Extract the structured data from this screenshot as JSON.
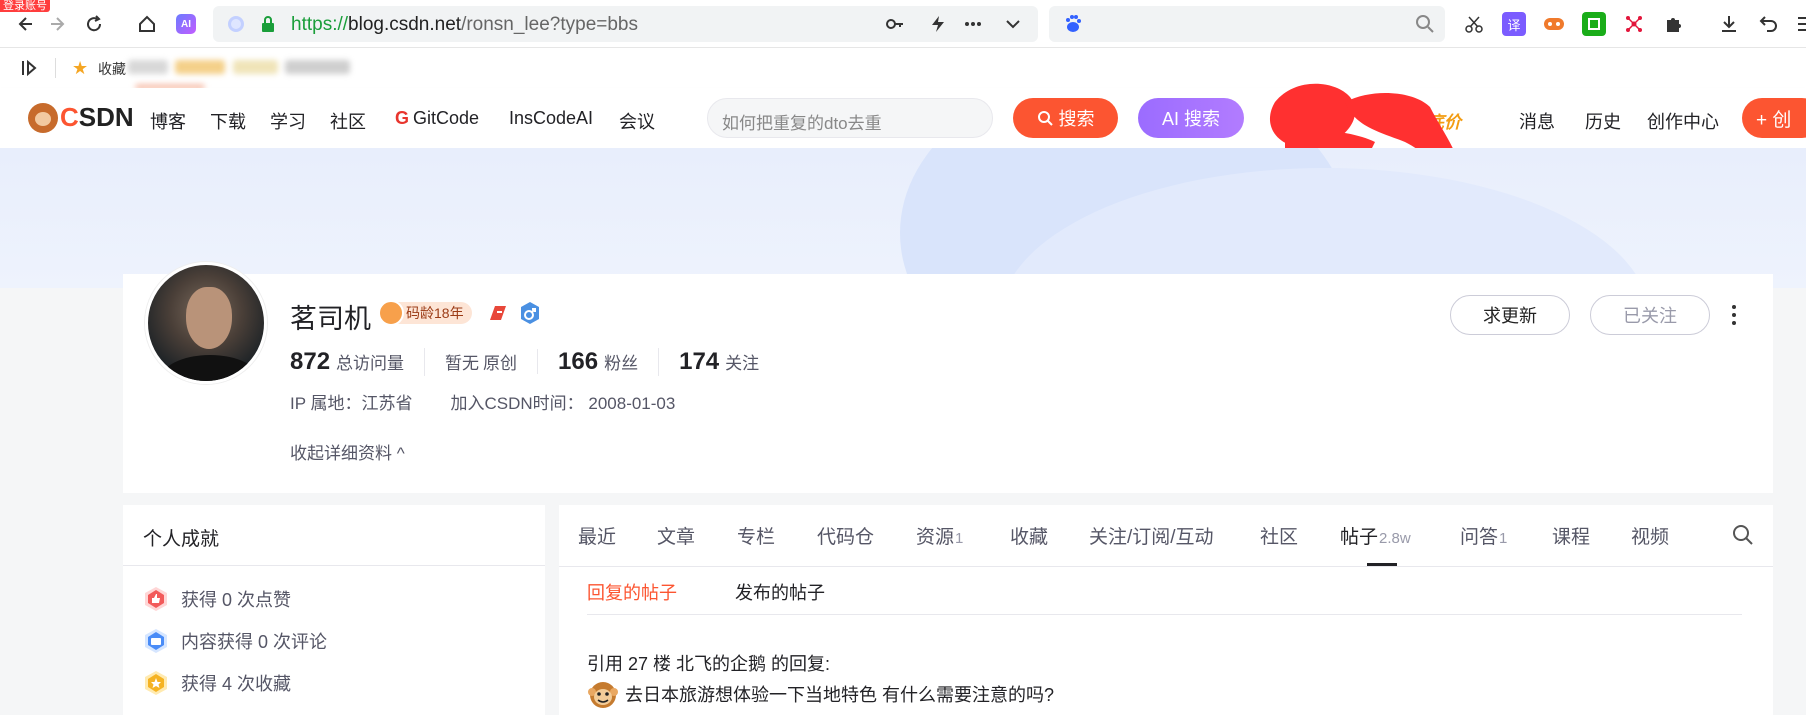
{
  "browser": {
    "login_tag": "登录账号",
    "url_proto": "https://",
    "url_host": "blog.csdn.net",
    "url_path": "/ronsn_lee?type=bbs",
    "ai_badge": "AI",
    "bookmark_label": "收藏"
  },
  "header": {
    "logo_c": "C",
    "logo_rest": "SDN",
    "nav": [
      "博客",
      "下载",
      "学习",
      "社区",
      "GitCode",
      "InsCodeAI",
      "会议"
    ],
    "search_placeholder": "如何把重复的dto去重",
    "search_button": "搜索",
    "ai_search_button": "AI 搜索",
    "hot_tag": "底价",
    "right_nav": [
      "消息",
      "历史",
      "创作中心"
    ],
    "create_button": "+ 创"
  },
  "profile": {
    "name": "茗司机",
    "badge_age": "码龄18年",
    "stats": [
      {
        "num": "872",
        "label": "总访问量"
      },
      {
        "num": "暂无",
        "label": "原创"
      },
      {
        "num": "166",
        "label": "粉丝"
      },
      {
        "num": "174",
        "label": "关注"
      }
    ],
    "ip": "IP 属地：江苏省",
    "joined": "加入CSDN时间： 2008-01-03",
    "collapse": "收起详细资料 ^",
    "btn_update": "求更新",
    "btn_followed": "已关注",
    "more_icon": "more-vertical-icon"
  },
  "achievements": {
    "title": "个人成就",
    "items": [
      {
        "icon": "like-icon",
        "text": "获得 0 次点赞"
      },
      {
        "icon": "comment-icon",
        "text": "内容获得 0 次评论"
      },
      {
        "icon": "favorite-icon",
        "text": "获得 4 次收藏"
      }
    ]
  },
  "content": {
    "tabs": [
      {
        "label": "最近",
        "count": ""
      },
      {
        "label": "文章",
        "count": ""
      },
      {
        "label": "专栏",
        "count": ""
      },
      {
        "label": "代码仓",
        "count": ""
      },
      {
        "label": "资源",
        "count": "1"
      },
      {
        "label": "收藏",
        "count": ""
      },
      {
        "label": "关注/订阅/互动",
        "count": ""
      },
      {
        "label": "社区",
        "count": ""
      },
      {
        "label": "帖子",
        "count": "2.8w"
      },
      {
        "label": "问答",
        "count": "1"
      },
      {
        "label": "课程",
        "count": ""
      },
      {
        "label": "视频",
        "count": ""
      }
    ],
    "active_tab": "帖子",
    "subtabs": [
      "回复的帖子",
      "发布的帖子"
    ],
    "post_quote": "引用 27 楼 北飞的企鹅 的回复:",
    "post_text": "去日本旅游想体验一下当地特色 有什么需要注意的吗?"
  },
  "colors": {
    "accent": "#fc5531",
    "ai_purple": "#9b6cff",
    "banner": "#e8eefc"
  }
}
